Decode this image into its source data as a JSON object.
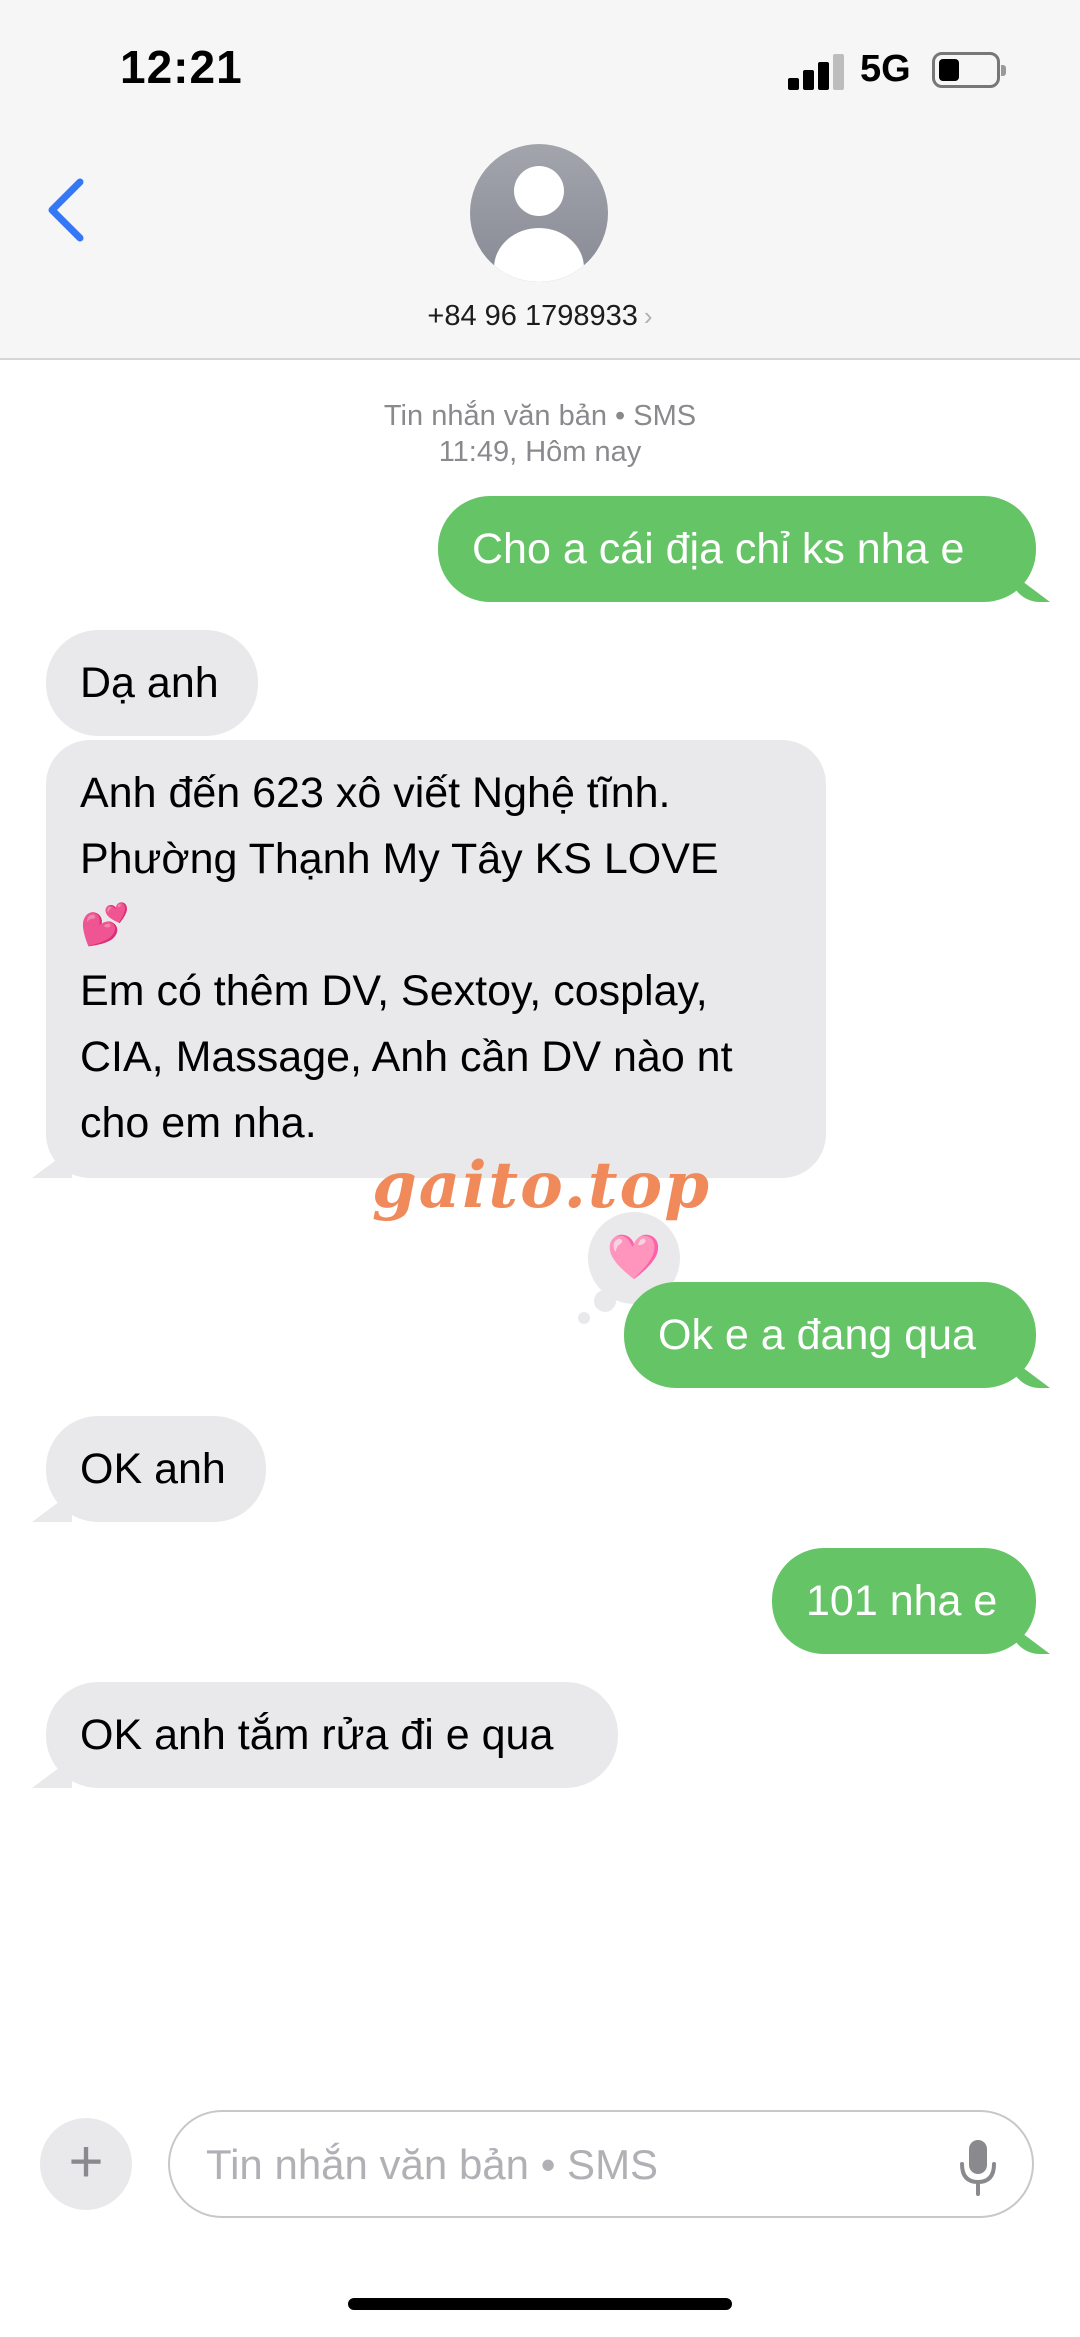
{
  "status": {
    "time": "12:21",
    "network": "5G"
  },
  "header": {
    "contact": "+84 96 1798933",
    "chevron": "›"
  },
  "meta": {
    "line1": "Tin nhắn văn bản • SMS",
    "line2": "11:49, Hôm nay"
  },
  "messages": [
    {
      "from": "me",
      "text": "Cho a cái địa chỉ ks nha e"
    },
    {
      "from": "them",
      "text": "Dạ anh"
    },
    {
      "from": "them",
      "lines": [
        "Anh đến 623 xô viết Nghệ tĩnh.",
        "Phường Thạnh My Tây KS LOVE",
        "💕",
        "Em có thêm DV, Sextoy, cosplay,",
        "CIA, Massage, Anh cần DV nào nt",
        "cho em nha."
      ]
    },
    {
      "from": "me",
      "text": "Ok e a đang qua"
    },
    {
      "from": "them",
      "text": "OK anh"
    },
    {
      "from": "me",
      "text": "101 nha e"
    },
    {
      "from": "them",
      "text": "OK anh tắm rửa đi e qua"
    }
  ],
  "reaction": "🩷",
  "watermark": "gaito.top",
  "composer": {
    "placeholder": "Tin nhắn văn bản • SMS",
    "plus": "+"
  },
  "colors": {
    "sent": "#65c466",
    "received": "#e9e9eb",
    "accent": "#3478f6"
  }
}
